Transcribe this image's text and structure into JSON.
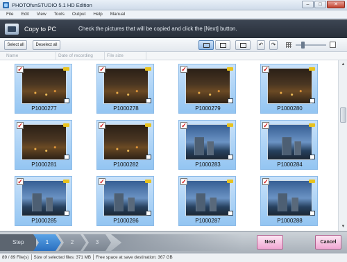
{
  "window": {
    "title": "PHOTOfunSTUDIO 5.1 HD Edition",
    "minimize_glyph": "–",
    "maximize_glyph": "□",
    "close_glyph": "✕"
  },
  "menu": [
    "File",
    "Edit",
    "View",
    "Tools",
    "Output",
    "Help",
    "Manual"
  ],
  "header": {
    "title": "Copy to PC",
    "instruction": "Check the pictures that will be copied and click the [Next] button."
  },
  "toolbar": {
    "select_all": "Select all",
    "deselect_all": "Deselect all",
    "rotate_left_glyph": "↶",
    "rotate_right_glyph": "↷"
  },
  "columns": [
    "Name",
    "Date of recording",
    "File size"
  ],
  "thumbnails": [
    {
      "name": "P1000277",
      "checked": true,
      "scene": "night"
    },
    {
      "name": "P1000278",
      "checked": true,
      "scene": "night"
    },
    {
      "name": "P1000279",
      "checked": true,
      "scene": "night"
    },
    {
      "name": "P1000280",
      "checked": true,
      "scene": "night"
    },
    {
      "name": "P1000281",
      "checked": true,
      "scene": "night"
    },
    {
      "name": "P1000282",
      "checked": true,
      "scene": "night"
    },
    {
      "name": "P1000283",
      "checked": true,
      "scene": "dusk"
    },
    {
      "name": "P1000284",
      "checked": true,
      "scene": "dusk"
    },
    {
      "name": "P1000285",
      "checked": true,
      "scene": "dusk"
    },
    {
      "name": "P1000286",
      "checked": true,
      "scene": "dusk"
    },
    {
      "name": "P1000287",
      "checked": true,
      "scene": "dusk"
    },
    {
      "name": "P1000288",
      "checked": true,
      "scene": "dusk"
    }
  ],
  "checkmark_glyph": "✓",
  "steps": {
    "label": "Step",
    "items": [
      "1",
      "2",
      "3"
    ],
    "active": "1"
  },
  "buttons": {
    "next": "Next",
    "cancel": "Cancel"
  },
  "status": {
    "files": "89 / 89 File(s)",
    "selected_size": "Size of selected files: 371 MB",
    "free_space": "Free space at save destination: 367 GB"
  },
  "colors": {
    "accent": "#2a6fbf",
    "thumb_bg": "#a9d1f6",
    "action_button": "#f0a7d3",
    "check": "#d01010"
  }
}
